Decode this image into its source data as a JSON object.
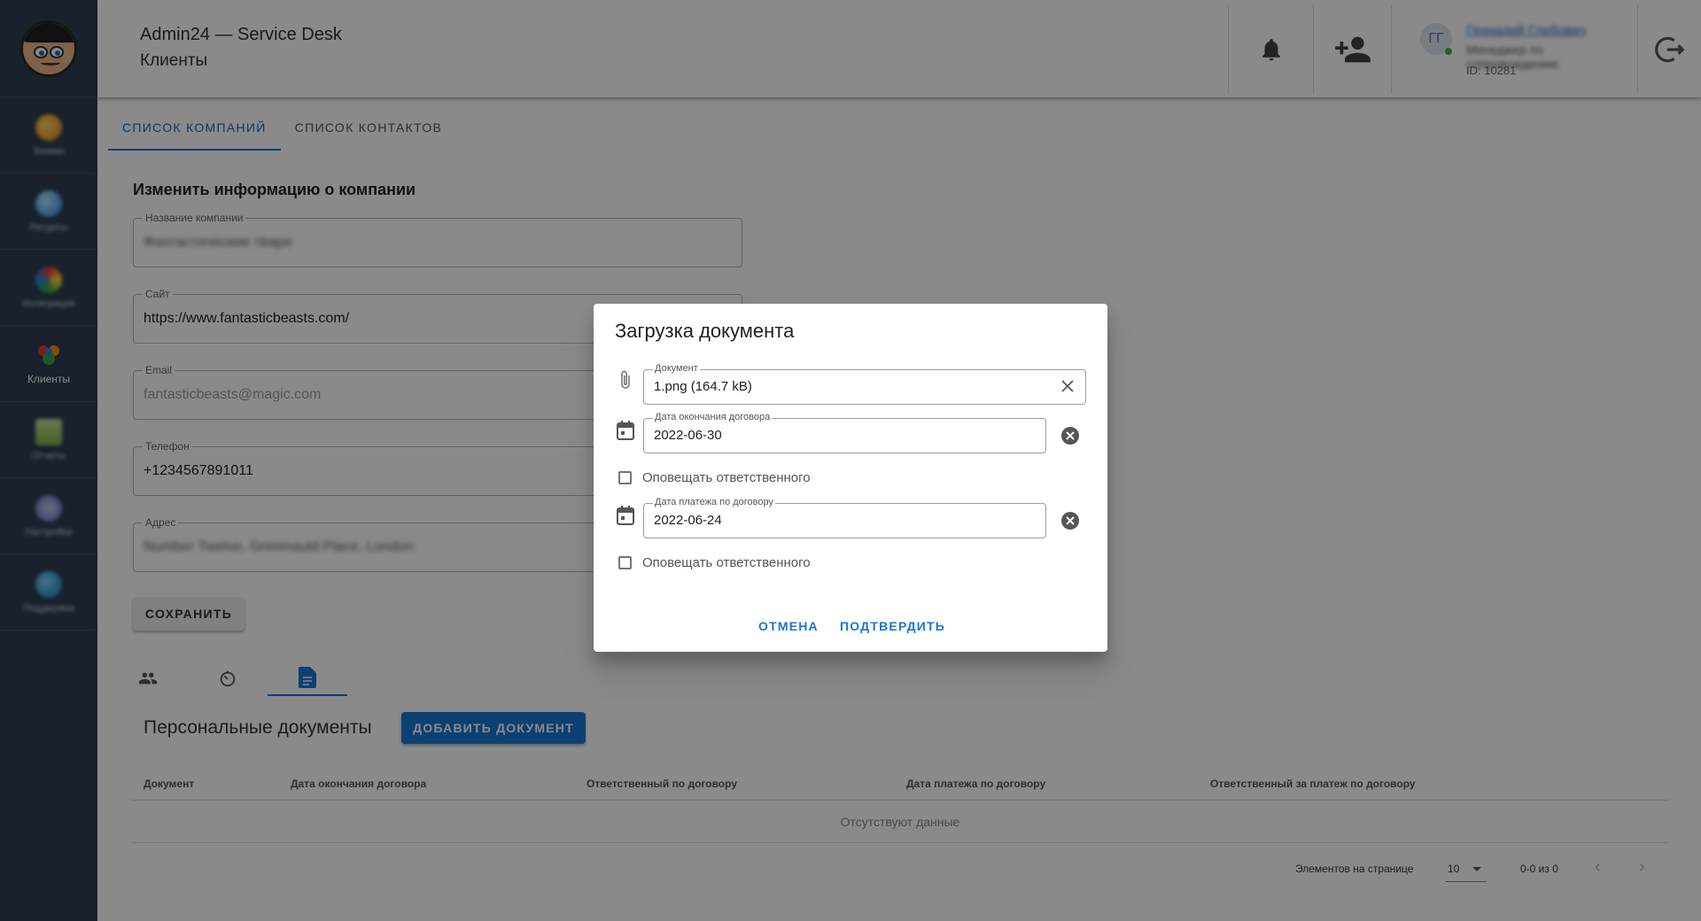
{
  "header": {
    "app_title": "Admin24 — Service Desk",
    "page_title": "Клиенты",
    "user": {
      "initials": "ГГ",
      "name": "Геннадий Глебович",
      "role": "Менеджер по сопровождению",
      "id": "ID: 10281"
    }
  },
  "sidebar": {
    "items": [
      {
        "label": "Заявки",
        "icon": "tickets-icon",
        "color": "#f2a43a"
      },
      {
        "label": "Ресурсы",
        "icon": "resources-icon",
        "color": "#4fc3f7"
      },
      {
        "label": "Интеграция",
        "icon": "integration-icon",
        "color": "#ef6c00"
      },
      {
        "label": "Клиенты",
        "icon": "clients-icon",
        "color": "#e53935"
      },
      {
        "label": "Отчеты",
        "icon": "reports-icon",
        "color": "#9ccc65"
      },
      {
        "label": "Настройки",
        "icon": "settings-icon",
        "color": "#7e9ad8"
      },
      {
        "label": "Поддержка",
        "icon": "support-icon",
        "color": "#29b6f6"
      }
    ]
  },
  "main": {
    "tabs": [
      {
        "label": "СПИСОК КОМПАНИЙ",
        "active": true
      },
      {
        "label": "СПИСОК КОНТАКТОВ",
        "active": false
      }
    ],
    "section_title": "Изменить информацию о компании",
    "fields": {
      "company": {
        "label": "Название компании",
        "value": "Фантастические твари"
      },
      "site": {
        "label": "Сайт",
        "value": "https://www.fantasticbeasts.com/"
      },
      "email": {
        "label": "Email",
        "value": "fantasticbeasts@magic.com"
      },
      "phone": {
        "label": "Телефон",
        "value": "+1234567891011"
      },
      "address": {
        "label": "Адрес",
        "value": "Number Twelve, Grimmauld Place, London"
      }
    },
    "save_label": "СОХРАНИТЬ",
    "subtabs": [
      "people-icon",
      "timer-icon",
      "document-icon"
    ],
    "docs_title": "Персональные документы",
    "add_doc_label": "ДОБАВИТЬ ДОКУМЕНТ",
    "table": {
      "columns": [
        "Документ",
        "Дата окончания договора",
        "Ответственный по договору",
        "Дата платежа по договору",
        "Ответственный за платеж по договору"
      ],
      "empty_text": "Отсутствуют данные"
    },
    "pagination": {
      "rows_label": "Элементов на странице",
      "rows_value": "10",
      "range": "0-0 из 0"
    }
  },
  "dialog": {
    "title": "Загрузка документа",
    "document": {
      "label": "Документ",
      "value": "1.png (164.7 kB)"
    },
    "end_date": {
      "label": "Дата окончания договора",
      "value": "2022-06-30"
    },
    "notify1": "Оповещать ответственного",
    "pay_date": {
      "label": "Дата платежа по договору",
      "value": "2022-06-24"
    },
    "notify2": "Оповещать ответственного",
    "cancel_label": "ОТМЕНА",
    "confirm_label": "ПОДТВЕРДИТЬ"
  }
}
